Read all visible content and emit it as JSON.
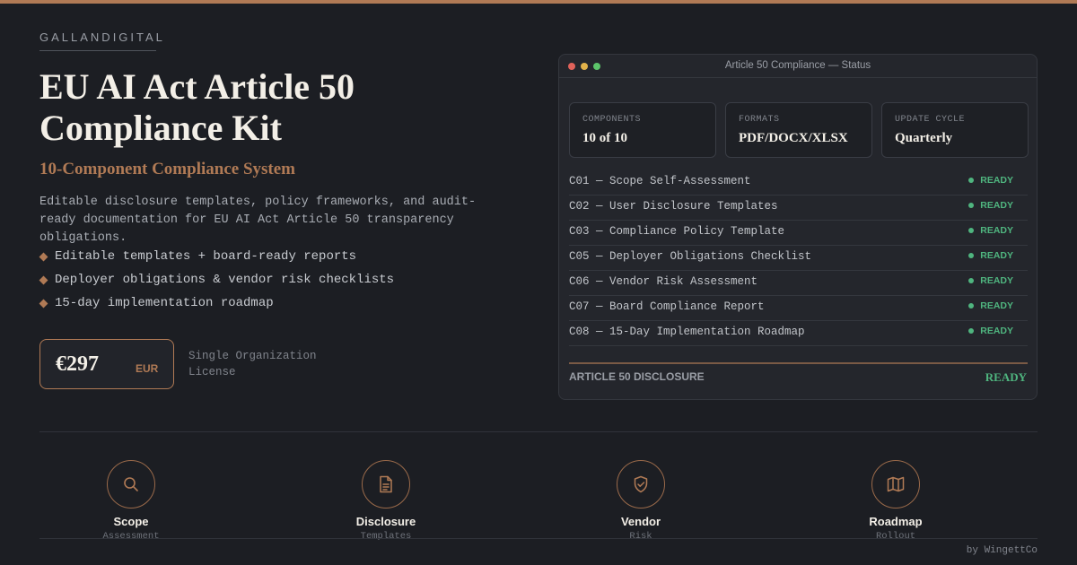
{
  "brand": "GALLANDIGITAL",
  "title": "EU AI Act Article 50 Compliance Kit",
  "subtitle": "10-Component Compliance System",
  "description": "Editable disclosure templates, policy frameworks, and audit-ready documentation for EU AI Act Article 50 transparency obligations.",
  "bullets": [
    "Editable templates + board-ready reports",
    "Deployer obligations & vendor risk checklists",
    "15-day implementation roadmap"
  ],
  "price": {
    "value": "€297",
    "currency": "EUR",
    "license": "Single Organization License"
  },
  "panel": {
    "title": "Article 50 Compliance — Status",
    "stats": [
      {
        "label": "COMPONENTS",
        "value": "10 of 10"
      },
      {
        "label": "FORMATS",
        "value": "PDF/DOCX/XLSX"
      },
      {
        "label": "UPDATE CYCLE",
        "value": "Quarterly"
      }
    ],
    "components": [
      {
        "label": "C01 — Scope Self-Assessment",
        "status": "READY"
      },
      {
        "label": "C02 — User Disclosure Templates",
        "status": "READY"
      },
      {
        "label": "C03 — Compliance Policy Template",
        "status": "READY"
      },
      {
        "label": "C05 — Deployer Obligations Checklist",
        "status": "READY"
      },
      {
        "label": "C06 — Vendor Risk Assessment",
        "status": "READY"
      },
      {
        "label": "C07 — Board Compliance Report",
        "status": "READY"
      },
      {
        "label": "C08 — 15-Day Implementation Roadmap",
        "status": "READY"
      }
    ],
    "footer_label": "ARTICLE 50 DISCLOSURE",
    "footer_status": "READY"
  },
  "features": [
    {
      "icon": "search-icon",
      "title": "Scope",
      "subtitle": "Assessment"
    },
    {
      "icon": "document-icon",
      "title": "Disclosure",
      "subtitle": "Templates"
    },
    {
      "icon": "shield-icon",
      "title": "Vendor",
      "subtitle": "Risk"
    },
    {
      "icon": "map-icon",
      "title": "Roadmap",
      "subtitle": "Rollout"
    }
  ],
  "credit": "by WingettCo",
  "colors": {
    "background": "#1c1e23",
    "accent": "#b07a55",
    "ready": "#4fb57f",
    "window_dots": [
      "#e0625a",
      "#e2b24a",
      "#5cc46a"
    ]
  }
}
